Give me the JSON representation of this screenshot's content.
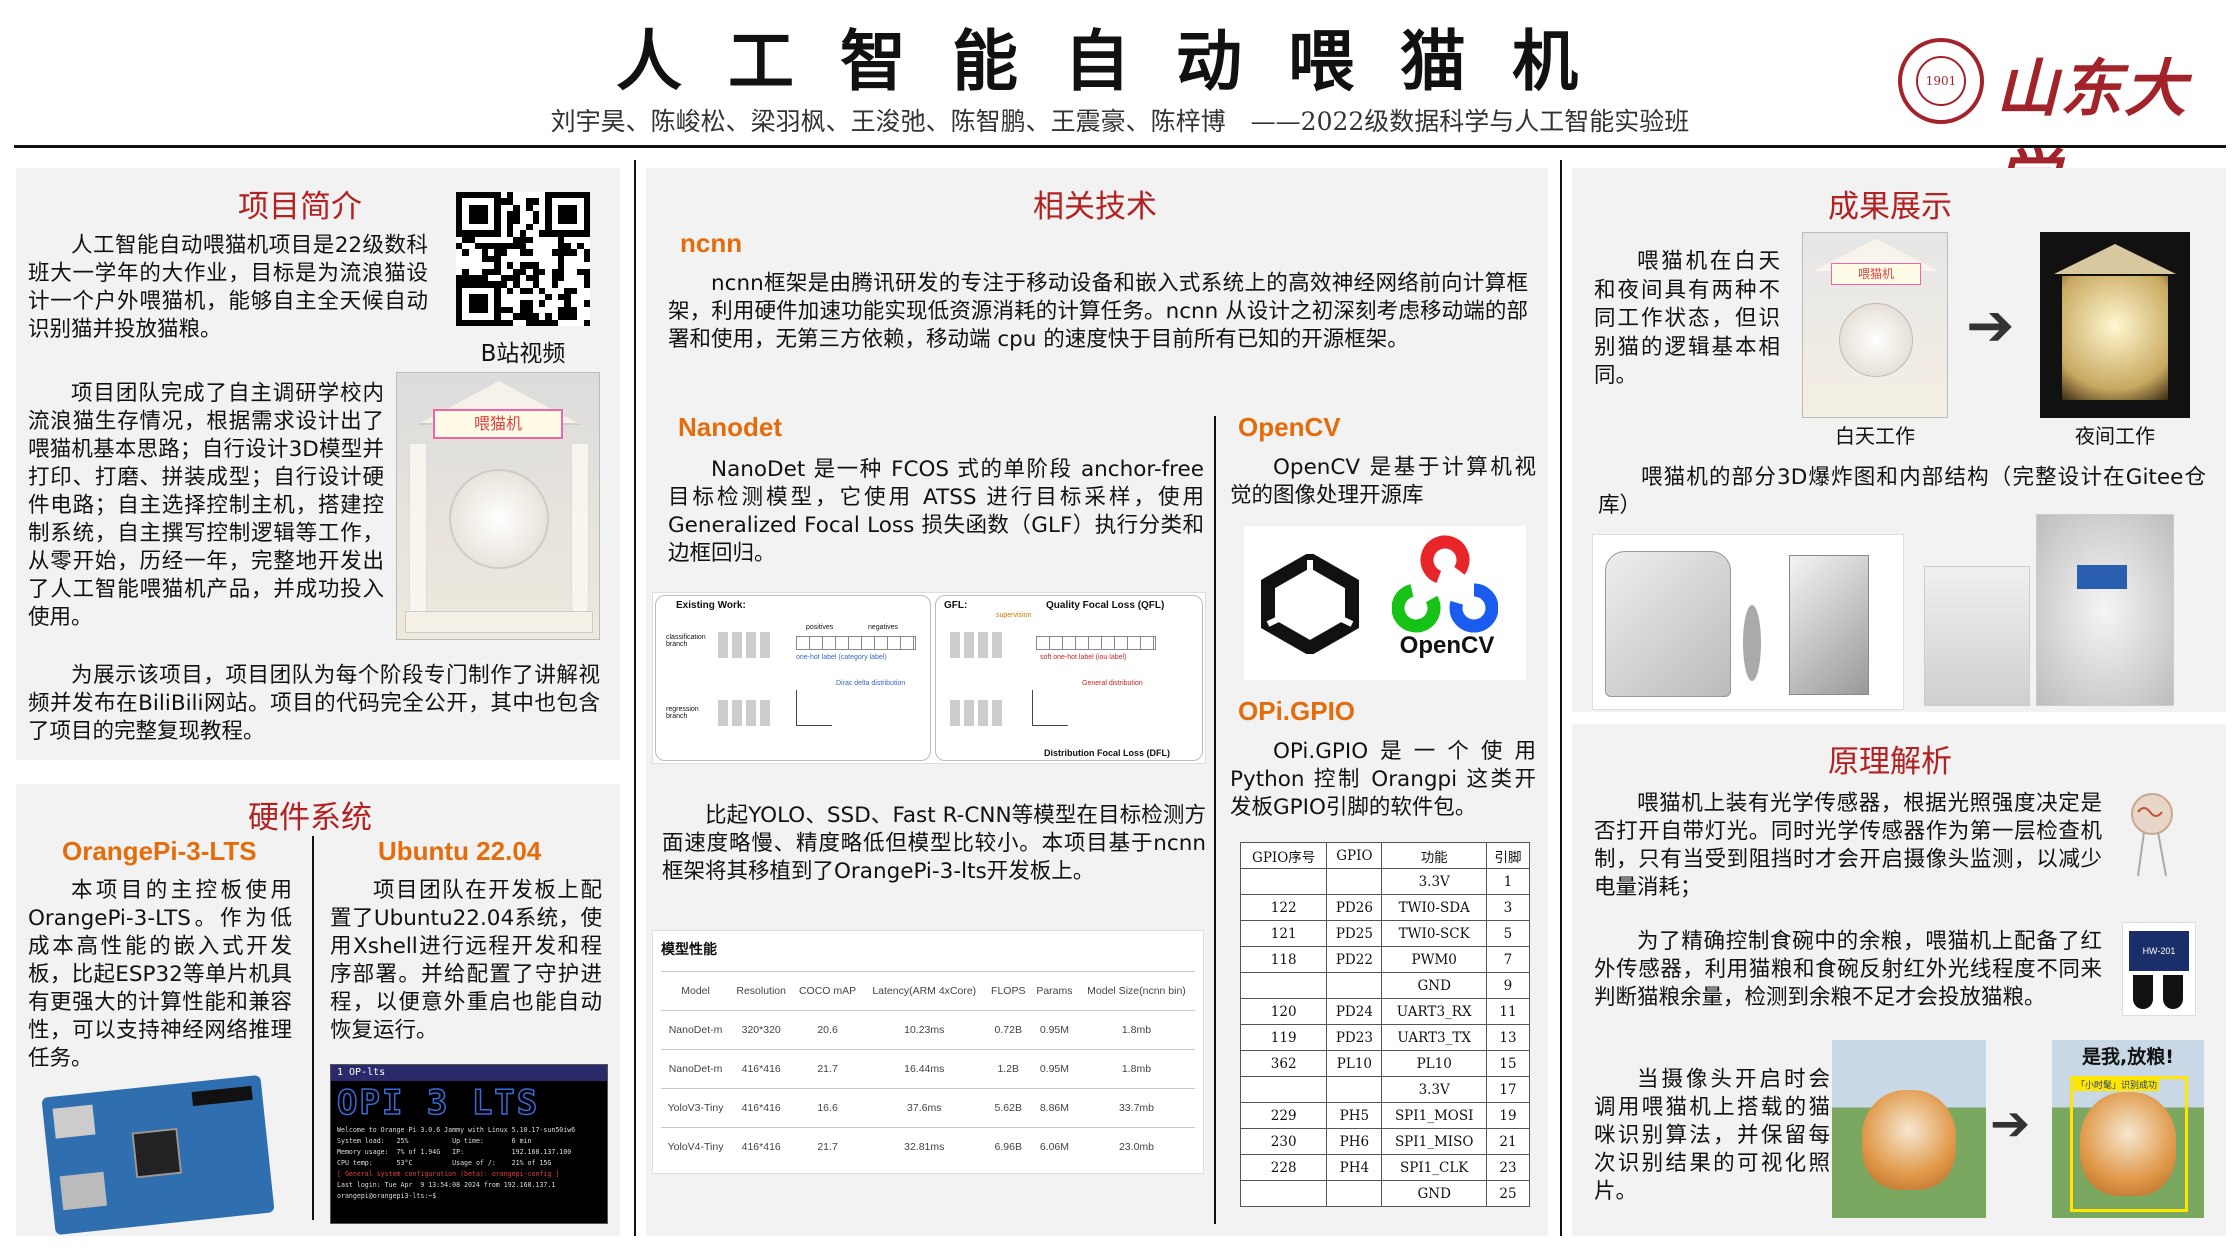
{
  "header": {
    "title": "人工智能自动喂猫机",
    "authors": "刘宇昊、陈峻松、梁羽枫、王浚弛、陈智鹏、王震豪、陈梓博　——2022级数据科学与人工智能实验班",
    "logo_text": "山东大学",
    "seal_text": "1901"
  },
  "intro": {
    "title": "项目简介",
    "p1": "人工智能自动喂猫机项目是22级数科班大一学年的大作业，目标是为流浪猫设计一个户外喂猫机，能够自主全天候自动识别猫并投放猫粮。",
    "qr_caption": "B站视频",
    "p2": "项目团队完成了自主调研学校内流浪猫生存情况，根据需求设计出了喂猫机基本思路；自行设计3D模型并打印、打磨、拼装成型；自行设计硬件电路；自主选择控制主机，搭建控制系统，自主撰写控制逻辑等工作，从零开始，历经一年，完整地开发出了人工智能喂猫机产品，并成功投入使用。",
    "feeder_label": "喂猫机",
    "p3": "为展示该项目，项目团队为每个阶段专门制作了讲解视频并发布在BiliBili网站。项目的代码完全公开，其中也包含了项目的完整复现教程。"
  },
  "hardware": {
    "title": "硬件系统",
    "left_sub": "OrangePi-3-LTS",
    "left_text": "本项目的主控板使用OrangePi-3-LTS。作为低成本高性能的嵌入式开发板，比起ESP32等单片机具有更强大的计算性能和兼容性，可以支持神经网络推理任务。",
    "right_sub": "Ubuntu 22.04",
    "right_text": "项目团队在开发板上配置了Ubuntu22.04系统，使用Xshell进行远程开发和程序部署。并给配置了守护进程，以便意外重启也能自动恢复运行。",
    "terminal_tab": "1 OP-lts",
    "terminal_banner": "OPI 3 LTS",
    "terminal_lines": [
      "Welcome to Orange Pi 3.0.6 Jammy with Linux 5.10.17-sun50iw6",
      "System load:   25%           Up time:       6 min",
      "Memory usage:  7% of 1.94G   IP:            192.168.137.100",
      "CPU temp:      53°C          Usage of /:    21% of 15G",
      "[ General system configuration (beta): orangepi-config ]",
      "Last login: Tue Apr  9 13:54:08 2024 from 192.168.137.1",
      "orangepi@orangepi3-lts:~$"
    ]
  },
  "tech": {
    "title": "相关技术",
    "ncnn_sub": "ncnn",
    "ncnn_text": "ncnn框架是由腾讯研发的专注于移动设备和嵌入式系统上的高效神经网络前向计算框架，利用硬件加速功能实现低资源消耗的计算任务。ncnn 从设计之初深刻考虑移动端的部署和使用，无第三方依赖，移动端 cpu 的速度快于目前所有已知的开源框架。",
    "nanodet_sub": "Nanodet",
    "nanodet_text": "NanoDet 是一种 FCOS 式的单阶段 anchor-free 目标检测模型，它使用 ATSS 进行目标采样，使用 Generalized Focal Loss 损失函数（GLF）执行分类和边框回归。",
    "diagram_left_title": "Existing Work:",
    "diagram_right_title": "GFL:",
    "diagram_qfl": "Quality Focal Loss (QFL)",
    "diagram_dfl": "Distribution Focal Loss (DFL)",
    "diagram_cls": "classification branch",
    "diagram_reg": "regression branch",
    "diagram_pos": "positives",
    "diagram_neg": "negatives",
    "diagram_onehot": "one-hot label (category label)",
    "diagram_soft": "soft one-hot label (iou label)",
    "diagram_dirac": "Dirac delta distribution",
    "diagram_general": "General distribution",
    "diagram_supervision": "supervision",
    "compare_text": "比起YOLO、SSD、Fast R-CNN等模型在目标检测方面速度略慢、精度略低但模型比较小。本项目基于ncnn框架将其移植到了OrangePi-3-lts开发板上。",
    "model_table_title": "模型性能",
    "model_table": {
      "headers": [
        "Model",
        "Resolution",
        "COCO mAP",
        "Latency(ARM 4xCore)",
        "FLOPS",
        "Params",
        "Model Size(ncnn bin)"
      ],
      "rows": [
        [
          "NanoDet-m",
          "320*320",
          "20.6",
          "10.23ms",
          "0.72B",
          "0.95M",
          "1.8mb"
        ],
        [
          "NanoDet-m",
          "416*416",
          "21.7",
          "16.44ms",
          "1.2B",
          "0.95M",
          "1.8mb"
        ],
        [
          "YoloV3-Tiny",
          "416*416",
          "16.6",
          "37.6ms",
          "5.62B",
          "8.86M",
          "33.7mb"
        ],
        [
          "YoloV4-Tiny",
          "416*416",
          "21.7",
          "32.81ms",
          "6.96B",
          "6.06M",
          "23.0mb"
        ]
      ]
    },
    "opencv_sub": "OpenCV",
    "opencv_text": "OpenCV 是基于计算机视觉的图像处理开源库",
    "opencv_logo": "OpenCV",
    "gpio_sub": "OPi.GPIO",
    "gpio_text": "OPi.GPIO是一个使用Python 控制 Orangpi 这类开发板GPIO引脚的软件包。",
    "gpio_table": {
      "headers": [
        "GPIO序号",
        "GPIO",
        "功能",
        "引脚"
      ],
      "rows": [
        [
          "",
          "",
          "3.3V",
          "1"
        ],
        [
          "122",
          "PD26",
          "TWI0-SDA",
          "3"
        ],
        [
          "121",
          "PD25",
          "TWI0-SCK",
          "5"
        ],
        [
          "118",
          "PD22",
          "PWM0",
          "7"
        ],
        [
          "",
          "",
          "GND",
          "9"
        ],
        [
          "120",
          "PD24",
          "UART3_RX",
          "11"
        ],
        [
          "119",
          "PD23",
          "UART3_TX",
          "13"
        ],
        [
          "362",
          "PL10",
          "PL10",
          "15"
        ],
        [
          "",
          "",
          "3.3V",
          "17"
        ],
        [
          "229",
          "PH5",
          "SPI1_MOSI",
          "19"
        ],
        [
          "230",
          "PH6",
          "SPI1_MISO",
          "21"
        ],
        [
          "228",
          "PH4",
          "SPI1_CLK",
          "23"
        ],
        [
          "",
          "",
          "GND",
          "25"
        ]
      ]
    }
  },
  "results": {
    "title": "成果展示",
    "text": "喂猫机在白天和夜间具有两种不同工作状态，但识别猫的逻辑基本相同。",
    "cap_day": "白天工作",
    "cap_night": "夜间工作",
    "day_label": "喂猫机",
    "model_text": "喂猫机的部分3D爆炸图和内部结构（完整设计在Gitee仓库）"
  },
  "principle": {
    "title": "原理解析",
    "p1": "喂猫机上装有光学传感器，根据光照强度决定是否打开自带灯光。同时光学传感器作为第一层检查机制，只有当受到阻挡时才会开启摄像头监测，以减少电量消耗；",
    "p2": "为了精确控制食碗中的余粮，喂猫机上配备了红外传感器，利用猫粮和食碗反射红外光线程度不同来判断猫粮余量，检测到余粮不足才会投放猫粮。",
    "sensor_label": "HW-201",
    "p3": "当摄像头开启时会调用喂猫机上搭载的猫咪识别算法，并保留每次识别结果的可视化照片。",
    "detect_banner": "是我,放粮!",
    "detect_label": "「小时髦」识别成功"
  }
}
